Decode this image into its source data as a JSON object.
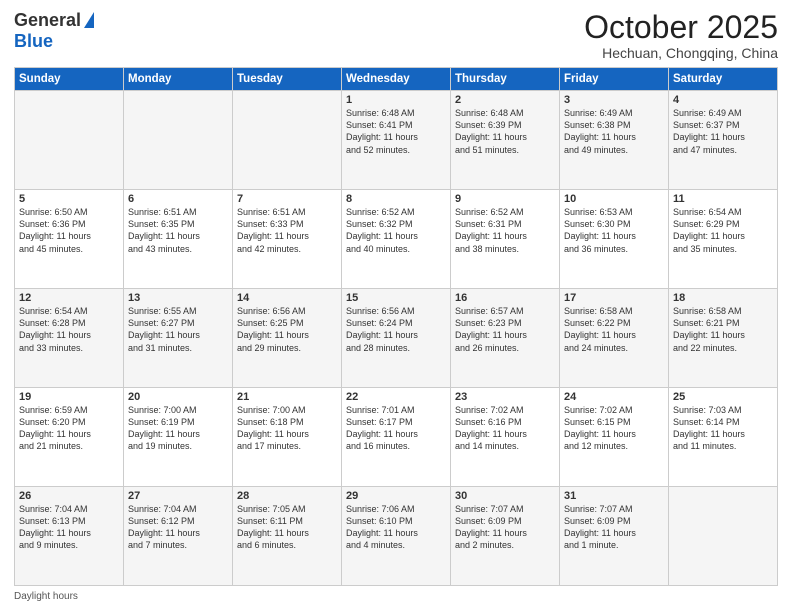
{
  "header": {
    "logo_general": "General",
    "logo_blue": "Blue",
    "month_title": "October 2025",
    "location": "Hechuan, Chongqing, China"
  },
  "footer": {
    "daylight_hours_label": "Daylight hours"
  },
  "weekdays": [
    "Sunday",
    "Monday",
    "Tuesday",
    "Wednesday",
    "Thursday",
    "Friday",
    "Saturday"
  ],
  "weeks": [
    [
      {
        "day": "",
        "info": ""
      },
      {
        "day": "",
        "info": ""
      },
      {
        "day": "",
        "info": ""
      },
      {
        "day": "1",
        "info": "Sunrise: 6:48 AM\nSunset: 6:41 PM\nDaylight: 11 hours\nand 52 minutes."
      },
      {
        "day": "2",
        "info": "Sunrise: 6:48 AM\nSunset: 6:39 PM\nDaylight: 11 hours\nand 51 minutes."
      },
      {
        "day": "3",
        "info": "Sunrise: 6:49 AM\nSunset: 6:38 PM\nDaylight: 11 hours\nand 49 minutes."
      },
      {
        "day": "4",
        "info": "Sunrise: 6:49 AM\nSunset: 6:37 PM\nDaylight: 11 hours\nand 47 minutes."
      }
    ],
    [
      {
        "day": "5",
        "info": "Sunrise: 6:50 AM\nSunset: 6:36 PM\nDaylight: 11 hours\nand 45 minutes."
      },
      {
        "day": "6",
        "info": "Sunrise: 6:51 AM\nSunset: 6:35 PM\nDaylight: 11 hours\nand 43 minutes."
      },
      {
        "day": "7",
        "info": "Sunrise: 6:51 AM\nSunset: 6:33 PM\nDaylight: 11 hours\nand 42 minutes."
      },
      {
        "day": "8",
        "info": "Sunrise: 6:52 AM\nSunset: 6:32 PM\nDaylight: 11 hours\nand 40 minutes."
      },
      {
        "day": "9",
        "info": "Sunrise: 6:52 AM\nSunset: 6:31 PM\nDaylight: 11 hours\nand 38 minutes."
      },
      {
        "day": "10",
        "info": "Sunrise: 6:53 AM\nSunset: 6:30 PM\nDaylight: 11 hours\nand 36 minutes."
      },
      {
        "day": "11",
        "info": "Sunrise: 6:54 AM\nSunset: 6:29 PM\nDaylight: 11 hours\nand 35 minutes."
      }
    ],
    [
      {
        "day": "12",
        "info": "Sunrise: 6:54 AM\nSunset: 6:28 PM\nDaylight: 11 hours\nand 33 minutes."
      },
      {
        "day": "13",
        "info": "Sunrise: 6:55 AM\nSunset: 6:27 PM\nDaylight: 11 hours\nand 31 minutes."
      },
      {
        "day": "14",
        "info": "Sunrise: 6:56 AM\nSunset: 6:25 PM\nDaylight: 11 hours\nand 29 minutes."
      },
      {
        "day": "15",
        "info": "Sunrise: 6:56 AM\nSunset: 6:24 PM\nDaylight: 11 hours\nand 28 minutes."
      },
      {
        "day": "16",
        "info": "Sunrise: 6:57 AM\nSunset: 6:23 PM\nDaylight: 11 hours\nand 26 minutes."
      },
      {
        "day": "17",
        "info": "Sunrise: 6:58 AM\nSunset: 6:22 PM\nDaylight: 11 hours\nand 24 minutes."
      },
      {
        "day": "18",
        "info": "Sunrise: 6:58 AM\nSunset: 6:21 PM\nDaylight: 11 hours\nand 22 minutes."
      }
    ],
    [
      {
        "day": "19",
        "info": "Sunrise: 6:59 AM\nSunset: 6:20 PM\nDaylight: 11 hours\nand 21 minutes."
      },
      {
        "day": "20",
        "info": "Sunrise: 7:00 AM\nSunset: 6:19 PM\nDaylight: 11 hours\nand 19 minutes."
      },
      {
        "day": "21",
        "info": "Sunrise: 7:00 AM\nSunset: 6:18 PM\nDaylight: 11 hours\nand 17 minutes."
      },
      {
        "day": "22",
        "info": "Sunrise: 7:01 AM\nSunset: 6:17 PM\nDaylight: 11 hours\nand 16 minutes."
      },
      {
        "day": "23",
        "info": "Sunrise: 7:02 AM\nSunset: 6:16 PM\nDaylight: 11 hours\nand 14 minutes."
      },
      {
        "day": "24",
        "info": "Sunrise: 7:02 AM\nSunset: 6:15 PM\nDaylight: 11 hours\nand 12 minutes."
      },
      {
        "day": "25",
        "info": "Sunrise: 7:03 AM\nSunset: 6:14 PM\nDaylight: 11 hours\nand 11 minutes."
      }
    ],
    [
      {
        "day": "26",
        "info": "Sunrise: 7:04 AM\nSunset: 6:13 PM\nDaylight: 11 hours\nand 9 minutes."
      },
      {
        "day": "27",
        "info": "Sunrise: 7:04 AM\nSunset: 6:12 PM\nDaylight: 11 hours\nand 7 minutes."
      },
      {
        "day": "28",
        "info": "Sunrise: 7:05 AM\nSunset: 6:11 PM\nDaylight: 11 hours\nand 6 minutes."
      },
      {
        "day": "29",
        "info": "Sunrise: 7:06 AM\nSunset: 6:10 PM\nDaylight: 11 hours\nand 4 minutes."
      },
      {
        "day": "30",
        "info": "Sunrise: 7:07 AM\nSunset: 6:09 PM\nDaylight: 11 hours\nand 2 minutes."
      },
      {
        "day": "31",
        "info": "Sunrise: 7:07 AM\nSunset: 6:09 PM\nDaylight: 11 hours\nand 1 minute."
      },
      {
        "day": "",
        "info": ""
      }
    ]
  ]
}
